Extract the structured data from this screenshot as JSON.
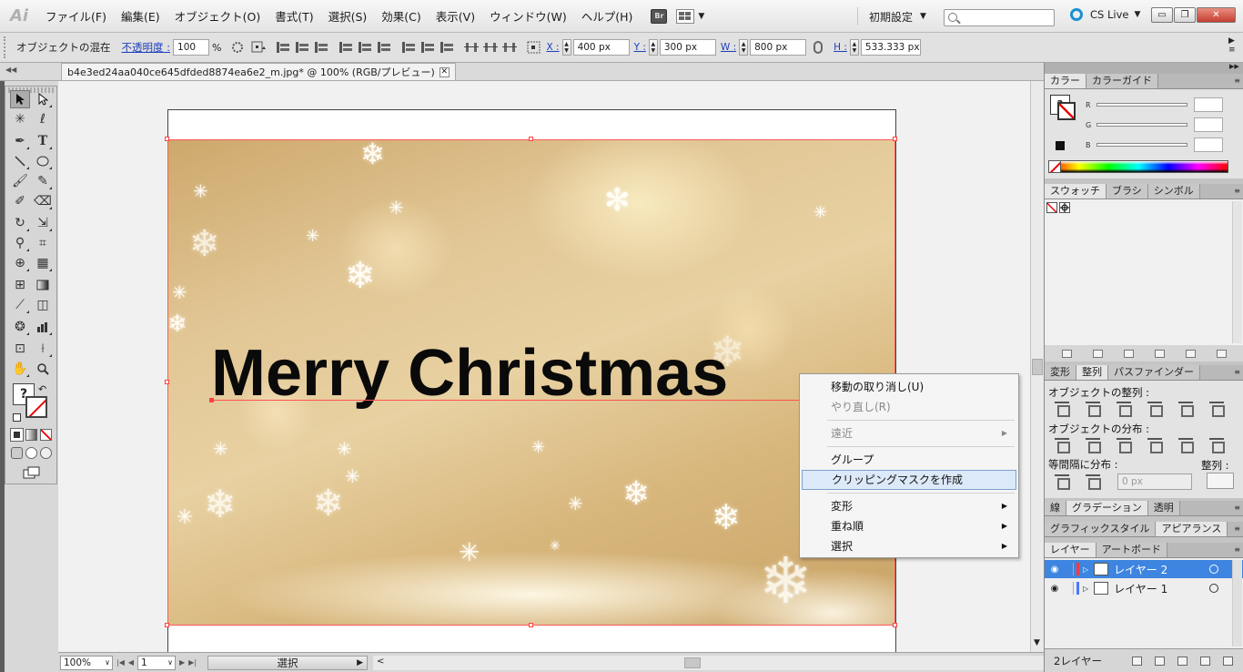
{
  "app": {
    "logo": "Ai"
  },
  "menu": [
    "ファイル(F)",
    "編集(E)",
    "オブジェクト(O)",
    "書式(T)",
    "選択(S)",
    "効果(C)",
    "表示(V)",
    "ウィンドウ(W)",
    "ヘルプ(H)"
  ],
  "bridge_label": "Br",
  "workspace": {
    "label": "初期設定",
    "chevron": "▼"
  },
  "search": {
    "placeholder": ""
  },
  "cslive": {
    "label": "CS Live",
    "chevron": "▼"
  },
  "window_buttons": {
    "minimize": "▭",
    "restore": "❐",
    "close": "✕"
  },
  "control": {
    "blend_label": "オブジェクトの混在",
    "opacity_label": "不透明度 :",
    "opacity_value": "100",
    "opacity_unit": "%",
    "x_label": "X :",
    "x_value": "400 px",
    "y_label": "Y :",
    "y_value": "300 px",
    "w_label": "W :",
    "w_value": "800 px",
    "h_label": "H :",
    "h_value": "533.333 px"
  },
  "document": {
    "tab_title": "b4e3ed24aa040ce645dfded8874ea6e2_m.jpg* @ 100% (RGB/プレビュー)",
    "close_label": "✕"
  },
  "artwork": {
    "text": "Merry Christmas"
  },
  "context_menu": {
    "items": [
      {
        "label": "移動の取り消し(U)",
        "disabled": false
      },
      {
        "label": "やり直し(R)",
        "disabled": true
      },
      {
        "label": "遠近",
        "disabled": true,
        "submenu": true
      },
      {
        "label": "グループ",
        "disabled": false
      },
      {
        "label": "クリッピングマスクを作成",
        "disabled": false,
        "highlighted": true
      },
      {
        "label": "変形",
        "submenu": true
      },
      {
        "label": "重ね順",
        "submenu": true
      },
      {
        "label": "選択",
        "submenu": true
      }
    ],
    "arrow": "▶"
  },
  "status": {
    "zoom": "100%",
    "page": "1",
    "mode": "選択"
  },
  "panels": {
    "color": {
      "tabs": [
        "カラー",
        "カラーガイド"
      ],
      "channels": [
        "R",
        "G",
        "B"
      ]
    },
    "swatches": {
      "tabs": [
        "スウォッチ",
        "ブラシ",
        "シンボル"
      ]
    },
    "align": {
      "tabs": [
        "変形",
        "整列",
        "パスファインダー"
      ],
      "align_objects": "オブジェクトの整列 :",
      "distribute_objects": "オブジェクトの分布 :",
      "distribute_spacing": "等間隔に分布 :",
      "spacing_value": "0 px",
      "align_to": "整列 :"
    },
    "stroke": {
      "tabs": [
        "線",
        "グラデーション",
        "透明"
      ]
    },
    "appearance": {
      "tabs": [
        "グラフィックスタイル",
        "アピアランス"
      ]
    },
    "layers": {
      "tabs": [
        "レイヤー",
        "アートボード"
      ],
      "rows": [
        {
          "name": "レイヤー 2",
          "color": "#ff3b3b",
          "active": true
        },
        {
          "name": "レイヤー 1",
          "color": "#4a78ff",
          "active": false
        }
      ],
      "count": "2レイヤー"
    }
  },
  "colors": {
    "selection": "#ff4040",
    "highlight": "#dce9f8",
    "layer_active": "#3d85e0"
  }
}
